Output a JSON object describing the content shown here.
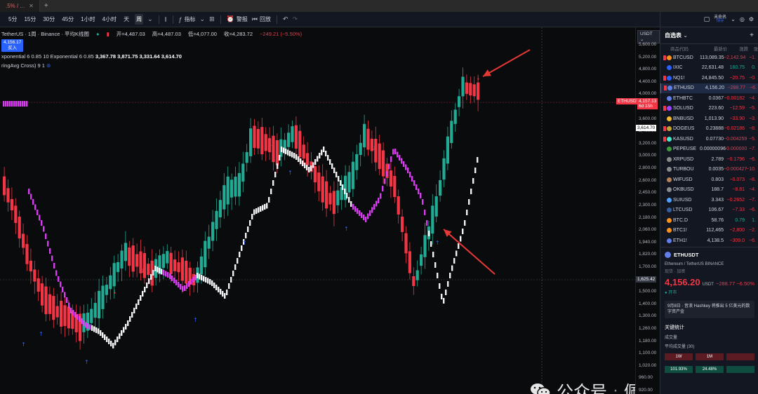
{
  "tab": {
    "title": ".5% / ...",
    "close": "✕",
    "add": "+"
  },
  "toolbar": {
    "timeframes": [
      "5分",
      "15分",
      "30分",
      "45分",
      "1小时",
      "4小时",
      "天",
      "周"
    ],
    "indicators_label": "指标",
    "alert_label": "警报",
    "replay_label": "回放"
  },
  "legend": {
    "symbol": "TetherUS · 1周 · Binance · 平均K线图",
    "open": "开=4,487.03",
    "high": "高=4,487.03",
    "low": "低=4,077.00",
    "close": "收=4,283.72",
    "change": "−249.21 (−5.50%)",
    "price_chip_value": "4,156.17",
    "price_chip_label": "买入",
    "indicator_label": "xponential 6 0.85 10 Exponential 6 0.85",
    "indicator_values": [
      "3,367.78",
      "3,871.75",
      "3,331.64",
      "3,614.70"
    ],
    "indicator2": "ringAvg Cross) 9 1"
  },
  "axis": {
    "currency": "USDT",
    "ticks": [
      "5,600.00",
      "5,200.00",
      "4,800.00",
      "4,400.00",
      "4,000.00",
      "3,800.00",
      "3,600.00",
      "3,400.00",
      "3,200.00",
      "3,000.00",
      "2,800.00",
      "2,600.00",
      "2,450.00",
      "2,300.00",
      "2,180.00",
      "2,060.00",
      "1,940.00",
      "1,820.00",
      "1,700.00",
      "1,600.00",
      "1,500.00",
      "1,400.00",
      "1,300.00",
      "1,260.00",
      "1,180.00",
      "1,100.00",
      "1,020.00",
      "960.00",
      "920.00"
    ],
    "eth_tag": "ETHUSDT",
    "eth_price": "4,157.13",
    "eth_countdown": "6d 15h",
    "line_tag": "3,614.70",
    "cross_tag": "1,625.42"
  },
  "account": {
    "label": "未命名",
    "sub": "保存"
  },
  "watchlist": {
    "title": "自选表",
    "columns": {
      "symbol": "商品代码",
      "last": "最新价",
      "change": "涨跌",
      "pct": "涨"
    },
    "rows": [
      {
        "symbol": "BTCUSD",
        "last": "113,089.35",
        "change": "−2,142.94",
        "pct": "−1.",
        "flag": true,
        "coin": "#f7931a",
        "sel": false,
        "neg": true
      },
      {
        "symbol": "IXIC",
        "last": "22,631.48",
        "change": "160.75",
        "pct": "0.",
        "flag": false,
        "coin": "#2962ff",
        "sel": false,
        "neg": false
      },
      {
        "symbol": "NQ1!",
        "last": "24,845.50",
        "change": "−20.75",
        "pct": "−0.",
        "flag": true,
        "coin": "#2962ff",
        "sel": false,
        "neg": true
      },
      {
        "symbol": "ETHUSD",
        "last": "4,156.20",
        "change": "−288.77",
        "pct": "−6.",
        "flag": true,
        "coin": "#627eea",
        "sel": true,
        "neg": true
      },
      {
        "symbol": "ETHBTC",
        "last": "0.0367",
        "change": "−0.00182",
        "pct": "−4.",
        "flag": false,
        "coin": "#627eea",
        "sel": false,
        "neg": true
      },
      {
        "symbol": "SOLUSD",
        "last": "223.60",
        "change": "−12.59",
        "pct": "−5.",
        "flag": true,
        "coin": "#9945ff",
        "sel": false,
        "neg": true
      },
      {
        "symbol": "BNBUSD",
        "last": "1,013.90",
        "change": "−33.90",
        "pct": "−3.",
        "flag": false,
        "coin": "#f3ba2f",
        "sel": false,
        "neg": true
      },
      {
        "symbol": "DOGEUS",
        "last": "0.23888",
        "change": "−0.02186",
        "pct": "−8.",
        "flag": true,
        "coin": "#c2a633",
        "sel": false,
        "neg": true
      },
      {
        "symbol": "KASUSD",
        "last": "0.07730",
        "change": "−0.004259",
        "pct": "−5.",
        "flag": true,
        "coin": "#49eacb",
        "sel": false,
        "neg": true
      },
      {
        "symbol": "PEPEUSE",
        "last": "0.00000096",
        "change": "−0.000000",
        "pct": "−7.",
        "flag": false,
        "coin": "#3d9a3d",
        "sel": false,
        "neg": true
      },
      {
        "symbol": "XRPUSD",
        "last": "2.789",
        "change": "−0.1796",
        "pct": "−6.",
        "flag": false,
        "coin": "#8a8a8a",
        "sel": false,
        "neg": true
      },
      {
        "symbol": "TURBOU",
        "last": "0.0035",
        "change": "−0.000427",
        "pct": "−10.",
        "flag": false,
        "coin": "#8a8a8a",
        "sel": false,
        "neg": true
      },
      {
        "symbol": "WIFUSD",
        "last": "0.803",
        "change": "−0.073",
        "pct": "−8.",
        "flag": false,
        "coin": "#b5835a",
        "sel": false,
        "neg": true
      },
      {
        "symbol": "OKBUSD",
        "last": "188.7",
        "change": "−8.81",
        "pct": "−4.",
        "flag": false,
        "coin": "#8a8a8a",
        "sel": false,
        "neg": true
      },
      {
        "symbol": "SUIUSD",
        "last": "3.343",
        "change": "−0.2652",
        "pct": "−7.",
        "flag": false,
        "coin": "#4da2ff",
        "sel": false,
        "neg": true
      },
      {
        "symbol": "LTCUSD",
        "last": "106.67",
        "change": "−7.33",
        "pct": "−6.",
        "flag": false,
        "coin": "#345d9d",
        "sel": false,
        "neg": true
      },
      {
        "symbol": "BTC.D",
        "last": "58.76",
        "change": "0.79",
        "pct": "1.",
        "flag": false,
        "coin": "#f7931a",
        "sel": false,
        "neg": false
      },
      {
        "symbol": "BTC1!",
        "last": "112,465",
        "change": "−2,800",
        "pct": "−2.",
        "flag": false,
        "coin": "#f7931a",
        "sel": false,
        "neg": true
      },
      {
        "symbol": "ETH1!",
        "last": "4,138.5",
        "change": "−309.0",
        "pct": "−6.",
        "flag": false,
        "coin": "#627eea",
        "sel": false,
        "neg": true
      }
    ]
  },
  "detail": {
    "symbol": "ETHUSDT",
    "name": "Ethereum / TetherUS",
    "exchange": "BINANCE",
    "type": "现货 · 加密",
    "price": "4,156.20",
    "currency": "USDT",
    "change": "−288.77 −6.50%",
    "status": "● 开市",
    "news": "9月8日 · 音浪 Hashkey 将推出 5 亿美元的数字资产金",
    "stats_title": "关键统计",
    "stat1": "成交量",
    "stat2": "平均成交量 (30)",
    "perf": [
      {
        "label": "1W",
        "color": "#5c1b22"
      },
      {
        "label": "1M",
        "color": "#5c1b22"
      },
      {
        "label": "",
        "color": "#5c1b22"
      }
    ],
    "perf2": [
      {
        "label": "101.93%",
        "color": "#0f4d40"
      },
      {
        "label": "24.48%",
        "color": "#0f4d40"
      },
      {
        "label": "",
        "color": "#0f4d40"
      }
    ]
  },
  "watermark": {
    "prefix": "公众号",
    "dot": "·",
    "name": "佩佩梭哈"
  },
  "colors": {
    "up": "#22ab94",
    "down": "#f23645",
    "magenta": "#e040fb",
    "white": "#ffffff",
    "arrow": "#e53935"
  }
}
